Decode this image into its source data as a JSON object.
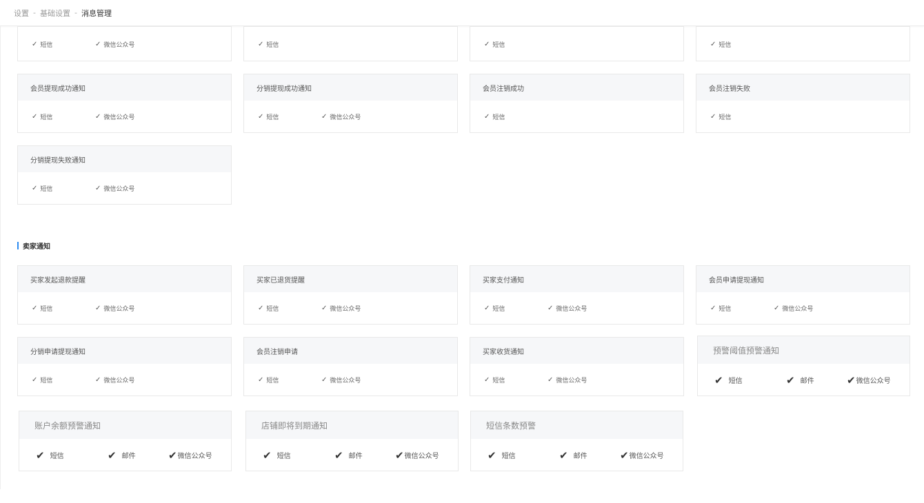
{
  "breadcrumb": {
    "items": [
      "设置",
      "基础设置",
      "消息管理"
    ],
    "separator": "-"
  },
  "section_seller": {
    "title": "卖家通知"
  },
  "labels": {
    "sms": "短信",
    "wechat": "微信公众号",
    "mail": "邮件",
    "wechat_tight": "微信公众号"
  },
  "cards": [
    {
      "title": "",
      "options": [
        "短信",
        "微信公众号"
      ]
    },
    {
      "title": "",
      "options": [
        "短信"
      ]
    },
    {
      "title": "",
      "options": [
        "短信"
      ]
    },
    {
      "title": "",
      "options": [
        "短信"
      ]
    },
    {
      "title": "会员提现成功通知",
      "options": [
        "短信",
        "微信公众号"
      ]
    },
    {
      "title": "分销提现成功通知",
      "options": [
        "短信",
        "微信公众号"
      ]
    },
    {
      "title": "会员注销成功",
      "options": [
        "短信"
      ]
    },
    {
      "title": "会员注销失败",
      "options": [
        "短信"
      ]
    },
    {
      "title": "分销提现失败通知",
      "options": [
        "短信",
        "微信公众号"
      ]
    },
    {
      "title": "买家发起退款提醒",
      "options": [
        "短信",
        "微信公众号"
      ]
    },
    {
      "title": "买家已退货提醒",
      "options": [
        "短信",
        "微信公众号"
      ]
    },
    {
      "title": "买家支付通知",
      "options": [
        "短信",
        "微信公众号"
      ]
    },
    {
      "title": "会员申请提现通知",
      "options": [
        "短信",
        "微信公众号"
      ]
    },
    {
      "title": "分销申请提现通知",
      "options": [
        "短信",
        "微信公众号"
      ]
    },
    {
      "title": "会员注销申请",
      "options": [
        "短信",
        "微信公众号"
      ]
    },
    {
      "title": "买家收货通知",
      "options": [
        "短信",
        "微信公众号"
      ]
    },
    {
      "title": "预警阈值预警通知",
      "options": [
        "短信",
        "邮件",
        "微信公众号"
      ]
    },
    {
      "title": "账户余额预警通知",
      "options": [
        "短信",
        "邮件",
        "微信公众号"
      ]
    },
    {
      "title": "店铺即将到期通知",
      "options": [
        "短信",
        "邮件",
        "微信公众号"
      ]
    },
    {
      "title": "短信条数预警",
      "options": [
        "短信",
        "邮件",
        "微信公众号"
      ]
    }
  ],
  "check_glyph": "✓",
  "check_glyph_bold": "✔"
}
